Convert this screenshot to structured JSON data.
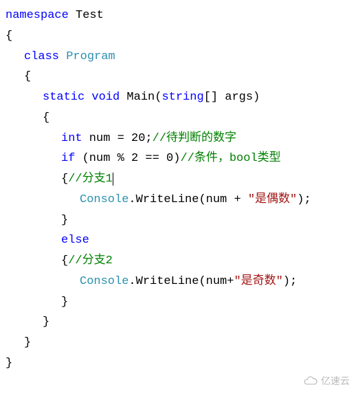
{
  "code": {
    "l1_kw": "namespace",
    "l1_name": " Test",
    "l2": "{",
    "l3_kw": "class",
    "l3_name": " Program",
    "l4": "{",
    "l5_kw1": "static",
    "l5_kw2": " void",
    "l5_name": " Main(",
    "l5_kw3": "string",
    "l5_tail": "[] args)",
    "l6": "{",
    "l7_kw": "int",
    "l7_code": " num = 20;",
    "l7_comment": "//待判断的数字",
    "l8_kw": "if",
    "l8_code": " (num % 2 == 0)",
    "l8_comment": "//条件，bool类型",
    "l9_brace": "{",
    "l9_comment": "//分支1",
    "l10_type": "Console",
    "l10_code": ".WriteLine(num + ",
    "l10_str": "\"是偶数\"",
    "l10_tail": ");",
    "l11": "}",
    "l12_kw": "else",
    "l13_brace": "{",
    "l13_comment": "//分支2",
    "l14_type": "Console",
    "l14_code": ".WriteLine(num+",
    "l14_str": "\"是奇数\"",
    "l14_tail": ");",
    "l15": "}",
    "l16": "}",
    "l17": "}",
    "l18": "}"
  },
  "watermark": "亿速云"
}
